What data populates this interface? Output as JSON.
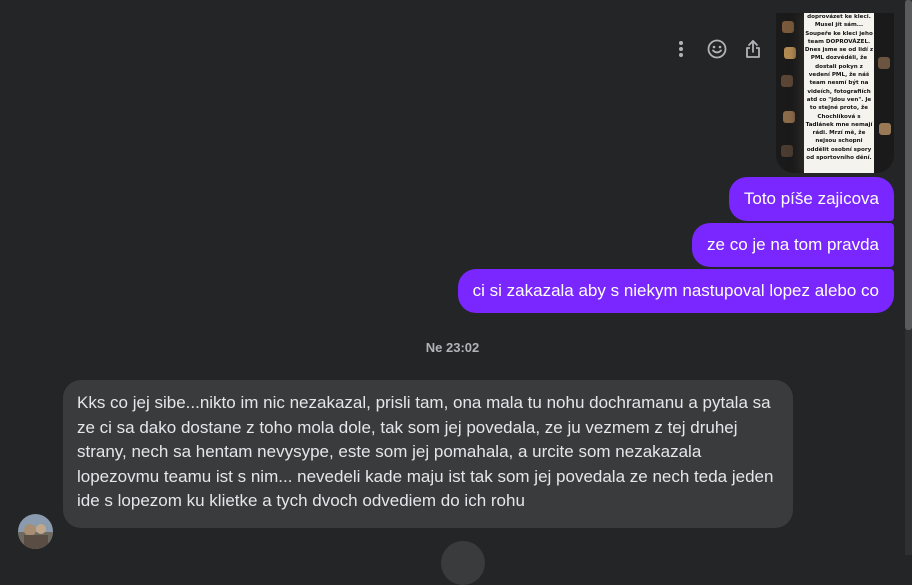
{
  "attachment": {
    "text": "doprovázet ke kleci.\nMusel jít sám...\nSoupeře ke kleci jeho\nteam DOPROVÁZEL.\nDnes jsme se od lidí z\nPML dozvěděli, že\ndostali pokyn z\nvedení PML, že náš\nteam nesmí být na\nvideích, fotografiích\natd co \"jdou ven\". Je\nto stejné proto, že\nChochlíková s\nTadlánek mne nemají\nrádi. Mrzí mě, že\nnejsou schopni\noddělit osobní spory\nod sportovního dění."
  },
  "messages": {
    "out": [
      "Toto píše zajicova",
      "ze co je na tom pravda",
      "ci si zakazala aby s niekym nastupoval lopez alebo co"
    ],
    "timestamp": "Ne 23:02",
    "in": "Kks co jej  sibe...nikto im nic nezakazal, prisli tam, ona mala tu nohu dochramanu a pytala sa ze ci sa dako dostane z toho mola dole, tak som jej povedala, ze ju vezmem z tej druhej strany, nech sa hentam nevysype, este som jej pomahala, a urcite som nezakazala lopezovmu teamu ist s nim... nevedeli kade maju ist tak som jej povedala ze nech teda jeden ide s lopezom ku klietke a tych dvoch odvediem do ich rohu"
  },
  "icons": [
    "more-vertical-icon",
    "emoji-icon",
    "share-icon"
  ],
  "colors": {
    "background": "#242526",
    "outgoing_bubble": "#7a26ff",
    "incoming_bubble": "#3a3b3c",
    "text_primary": "#e4e6eb",
    "text_secondary": "#b0b3b8"
  }
}
